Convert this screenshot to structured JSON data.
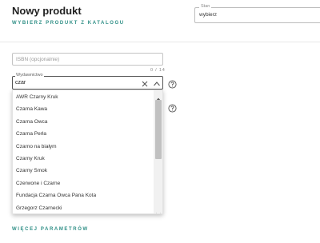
{
  "header": {
    "title": "Nowy produkt",
    "catalog_link": "WYBIERZ PRODUKT Z KATALOGU"
  },
  "stan": {
    "label": "Stan",
    "value": "wybierz"
  },
  "isbn": {
    "placeholder": "ISBN (opcjonalnie)",
    "counter": "0 / 14"
  },
  "publisher": {
    "label": "Wydawnictwo",
    "value": "czar",
    "options": [
      "AWR Czarny Kruk",
      "Czarna Kawa",
      "Czarna Owca",
      "Czarna Perła",
      "Czarno na białym",
      "Czarny Kruk",
      "Czarny Smok",
      "Czerwone i Czarne",
      "Fundacja Czarna Owca Pana Kota",
      "Grzegorz Czarnecki"
    ]
  },
  "footer": {
    "more_params": "WIĘCEJ PARAMETRÓW"
  },
  "icons": [
    "clear-icon",
    "chevron-up-icon",
    "help-icon",
    "scroll-up-arrow-icon",
    "scroll-down-arrow-icon"
  ],
  "colors": {
    "accent": "#2f8f86"
  }
}
